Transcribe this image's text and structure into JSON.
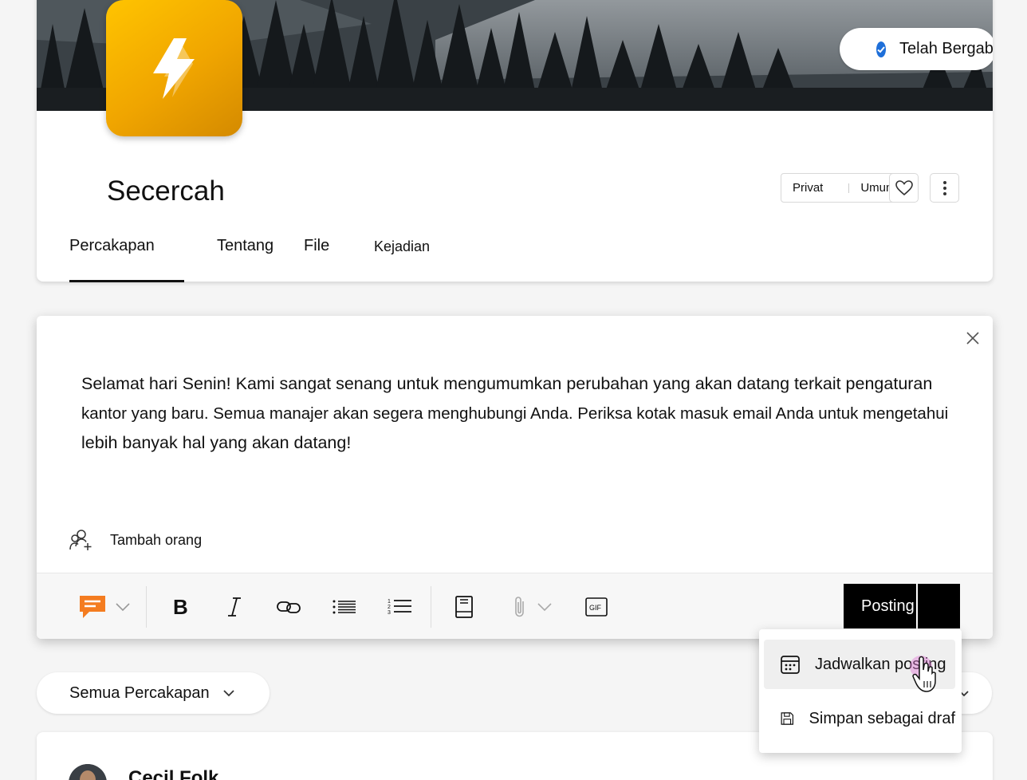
{
  "group": {
    "name": "Secercah",
    "joined_label": "Telah Bergabung",
    "privacy_options": [
      "Privat",
      "Umum"
    ]
  },
  "tabs": [
    {
      "label": "Percakapan",
      "active": true
    },
    {
      "label": "Tentang"
    },
    {
      "label": "File"
    },
    {
      "label": "Kejadian"
    }
  ],
  "composer": {
    "message_lines": [
      "Selamat hari Senin! Kami sangat senang untuk mengumumkan perubahan yang akan datang terkait pengaturan",
      "kantor yang baru. Semua manajer akan segera menghubungi Anda. Periksa kotak masuk email Anda untuk mengetahui",
      "lebih banyak hal yang akan datang!"
    ],
    "add_people_label": "Tambah orang",
    "post_label": "Posting",
    "gif_label": "GIF"
  },
  "post_menu": {
    "items": [
      {
        "label": "Jadwalkan posting",
        "icon": "calendar-icon",
        "hover": true
      },
      {
        "label": "Simpan sebagai draf",
        "icon": "save-icon"
      }
    ]
  },
  "filter": {
    "label": "Semua Percakapan"
  },
  "post": {
    "author": "Cecil Folk"
  },
  "colors": {
    "logo": "#f0a500",
    "accent": "#1e6fd9",
    "compose_icon": "#f47c20"
  }
}
